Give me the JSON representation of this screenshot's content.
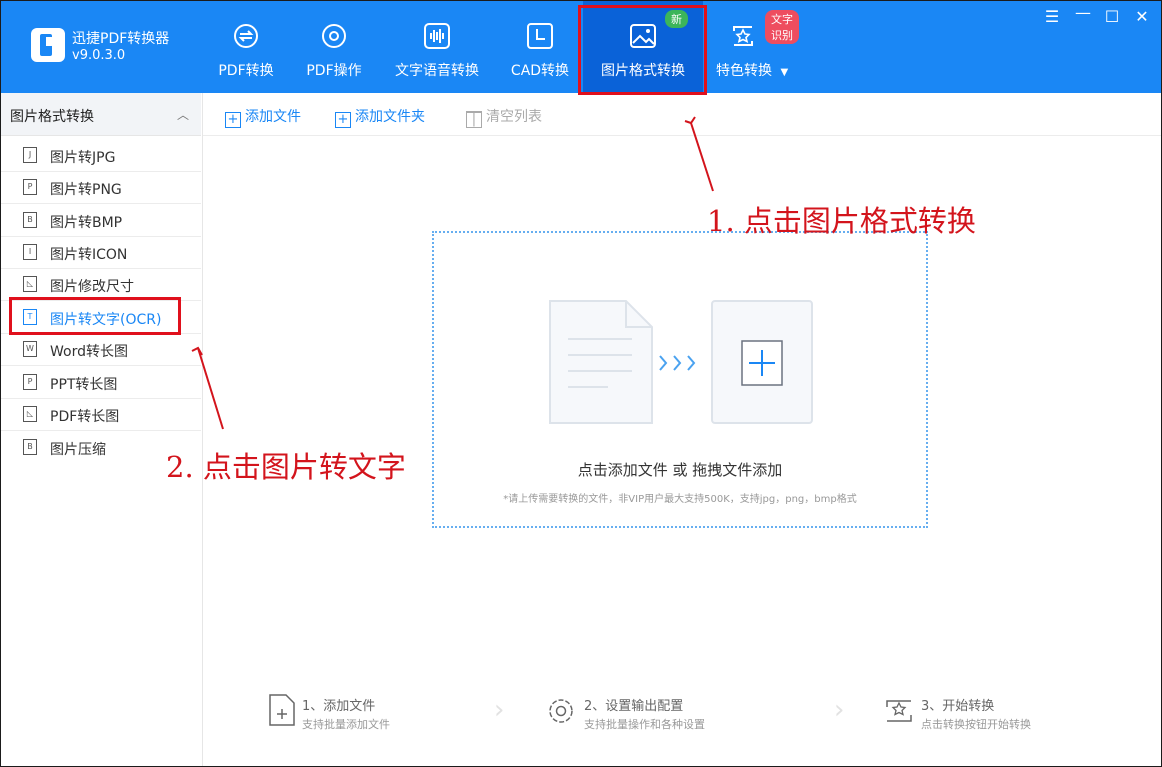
{
  "app": {
    "name": "迅捷PDF转换器",
    "version": "v9.0.3.0"
  },
  "tabs": [
    {
      "label": "PDF转换",
      "icon": "pdf-convert-icon"
    },
    {
      "label": "PDF操作",
      "icon": "pdf-operate-icon"
    },
    {
      "label": "文字语音转换",
      "icon": "voice-wave-icon"
    },
    {
      "label": "CAD转换",
      "icon": "cad-icon"
    },
    {
      "label": "图片格式转换",
      "icon": "image-icon",
      "active": true,
      "badge": "新"
    },
    {
      "label": "特色转换",
      "icon": "star-convert-icon",
      "badge": "文字识别"
    }
  ],
  "window_controls": [
    "menu-icon",
    "minimize-icon",
    "maximize-icon",
    "close-icon"
  ],
  "sidebar": {
    "title": "图片格式转换",
    "items": [
      {
        "label": "图片转JPG"
      },
      {
        "label": "图片转PNG"
      },
      {
        "label": "图片转BMP"
      },
      {
        "label": "图片转ICON"
      },
      {
        "label": "图片修改尺寸"
      },
      {
        "label": "图片转文字(OCR)",
        "active": true
      },
      {
        "label": "Word转长图"
      },
      {
        "label": "PPT转长图"
      },
      {
        "label": "PDF转长图"
      },
      {
        "label": "图片压缩"
      }
    ]
  },
  "toolbar": {
    "add_file": "添加文件",
    "add_folder": "添加文件夹",
    "clear_list": "清空列表"
  },
  "dropzone": {
    "main_text": "点击添加文件 或 拖拽文件添加",
    "hint": "*请上传需要转换的文件，非VIP用户最大支持500K，支持jpg，png，bmp格式"
  },
  "steps": [
    {
      "title": "1、添加文件",
      "subtitle": "支持批量添加文件"
    },
    {
      "title": "2、设置输出配置",
      "subtitle": "支持批量操作和各种设置"
    },
    {
      "title": "3、开始转换",
      "subtitle": "点击转换按钮开始转换"
    }
  ],
  "annotations": {
    "step1": "1. 点击图片格式转换",
    "step2": "2. 点击图片转文字"
  },
  "colors": {
    "brand": "#1a87f5",
    "active_tab": "#0a62d8",
    "highlight": "#e0101c",
    "badge_new": "#3cb55a",
    "badge_ocr": "#ee4d5f"
  }
}
